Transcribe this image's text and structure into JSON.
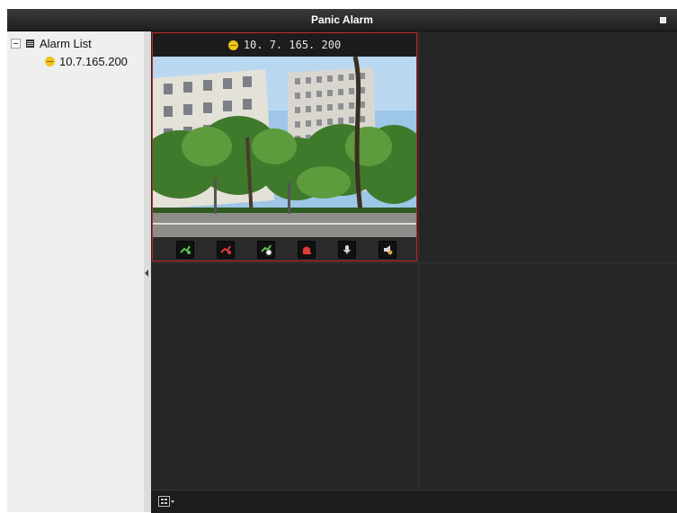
{
  "window": {
    "title": "Panic Alarm"
  },
  "sidebar": {
    "root_label": "Alarm List",
    "devices": [
      {
        "label": "10.7.165.200"
      }
    ]
  },
  "panel": {
    "header_label": "10. 7. 165. 200"
  },
  "colors": {
    "accent_border": "#c0262a",
    "device_icon": "#f0c419",
    "background": "#262626"
  },
  "icons": {
    "toolbar": [
      "alarm-acknowledge-icon",
      "alarm-clear-icon",
      "alarm-history-icon",
      "alarm-stop-icon",
      "microphone-icon",
      "speaker-icon"
    ]
  }
}
